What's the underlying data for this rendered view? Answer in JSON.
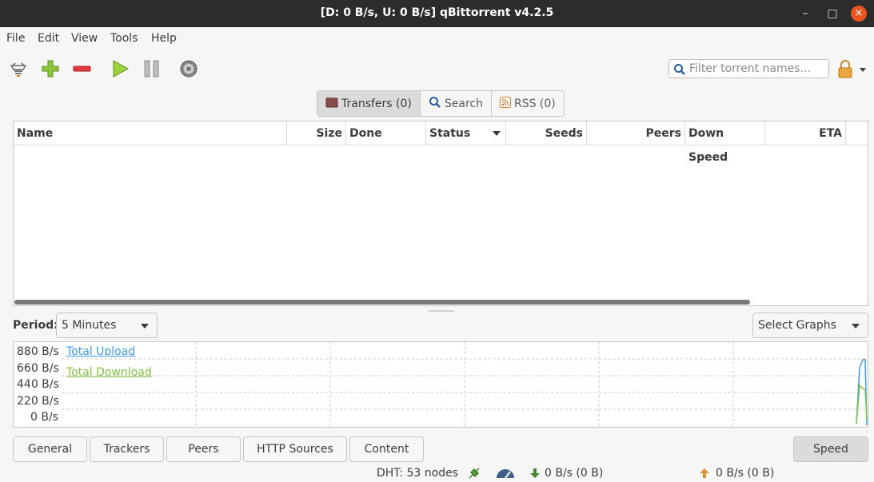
{
  "window": {
    "title": "[D: 0 B/s, U: 0 B/s] qBittorrent v4.2.5",
    "minimize_glyph": "–",
    "maximize_glyph": "□",
    "close_glyph": "×"
  },
  "menu": [
    "File",
    "Edit",
    "View",
    "Tools",
    "Help"
  ],
  "toolbar": {
    "buttons": [
      "add-torrent-link-icon",
      "add-torrent-icon",
      "delete-icon",
      "resume-icon",
      "pause-icon",
      "options-gear-icon"
    ],
    "filter_placeholder": "Filter torrent names...",
    "lock_icon": "lock-icon"
  },
  "tabs": [
    {
      "label": "Transfers (0)",
      "icon": "folder-icon",
      "active": true
    },
    {
      "label": "Search",
      "icon": "search-icon",
      "active": false
    },
    {
      "label": "RSS (0)",
      "icon": "rss-icon",
      "active": false
    }
  ],
  "table": {
    "columns": [
      "Name",
      "Size",
      "Done",
      "Status",
      "Seeds",
      "Peers",
      "Down Speed",
      "ETA"
    ],
    "rows": []
  },
  "speed_panel": {
    "period_label": "Period:",
    "period_value": "5 Minutes",
    "select_graphs": "Select Graphs",
    "y_ticks": [
      "880 B/s",
      "660 B/s",
      "440 B/s",
      "220 B/s",
      "0 B/s"
    ],
    "legend": [
      {
        "name": "Total Upload",
        "color": "#3d9be9"
      },
      {
        "name": "Total Download",
        "color": "#84c341"
      }
    ]
  },
  "bottom_tabs": [
    "General",
    "Trackers",
    "Peers",
    "HTTP Sources",
    "Content"
  ],
  "speed_button": "Speed",
  "status": {
    "dht": "DHT: 53 nodes",
    "download": "0 B/s (0 B)",
    "upload": "0 B/s (0 B)"
  },
  "colors": {
    "titlebar": "#2c2c2c",
    "close_button": "#e95420",
    "upload_series": "#3d9be9",
    "download_series": "#84c341"
  }
}
